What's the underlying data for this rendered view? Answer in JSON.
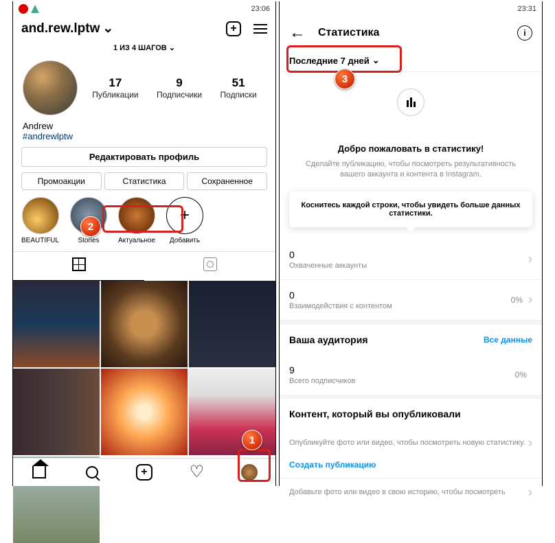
{
  "left": {
    "status_time": "23:06",
    "username": "and.rew.lptw",
    "steps": "1 ИЗ 4 ШАГОВ",
    "stats": {
      "posts_n": "17",
      "posts_l": "Публикации",
      "followers_n": "9",
      "followers_l": "Подписчики",
      "following_n": "51",
      "following_l": "Подписки"
    },
    "bio_name": "Andrew",
    "bio_tag": "#andrewlptw",
    "edit_btn": "Редактировать профиль",
    "b1": "Промоакции",
    "b2": "Статистика",
    "b3": "Сохраненное",
    "hl": {
      "a": "BEAUTIFUL",
      "b": "Stories",
      "c": "Актуальное",
      "d": "Добавить"
    }
  },
  "right": {
    "status_time": "23:31",
    "title": "Статистика",
    "filter": "Последние 7 дней",
    "welcome_title": "Добро пожаловать в статистику!",
    "welcome_sub": "Сделайте публикацию, чтобы посмотреть результативность вашего аккаунта и контента в Instagram.",
    "tooltip": "Коснитесь каждой строки, чтобы увидеть больше данных статистики.",
    "r1_n": "0",
    "r1_l": "Охваченные аккаунты",
    "r2_n": "0",
    "r2_l": "Взаимодействия с контентом",
    "r2_p": "0%",
    "aud_t": "Ваша аудитория",
    "aud_link": "Все данные",
    "r3_n": "9",
    "r3_l": "Всего подписчиков",
    "r3_p": "0%",
    "pub_t": "Контент, который вы опубликовали",
    "pub_sub": "Опубликуйте фото или видео, чтобы посмотреть новую статистику.",
    "pub_link": "Создать публикацию",
    "story_sub": "Добавьте фото или видео в свою историю, чтобы посмотреть"
  }
}
